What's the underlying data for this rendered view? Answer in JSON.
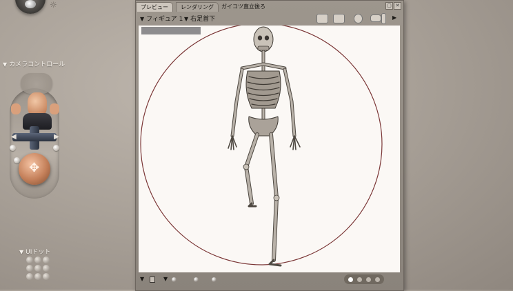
{
  "left_panel": {
    "camera_controls_label": "カメラコントロール",
    "ui_dots_label": "UIドット",
    "sun_icon": "☼"
  },
  "preview_window": {
    "tabs": [
      {
        "label": "プレビュー"
      },
      {
        "label": "レンダリング"
      }
    ],
    "camera_title": "ガイコツ直立後ろ",
    "window_buttons": [
      "▢",
      "✕"
    ],
    "toolbar": {
      "figure_dropdown": "フィギュア 1",
      "body_part_dropdown": "右足首下"
    },
    "viewport": {
      "background": "#fbf8f5",
      "guide_circle_color": "#7a3535",
      "bone_color": "#b8b1a8"
    },
    "bottom": {
      "pager_dots": 4,
      "active_page": 1
    }
  }
}
